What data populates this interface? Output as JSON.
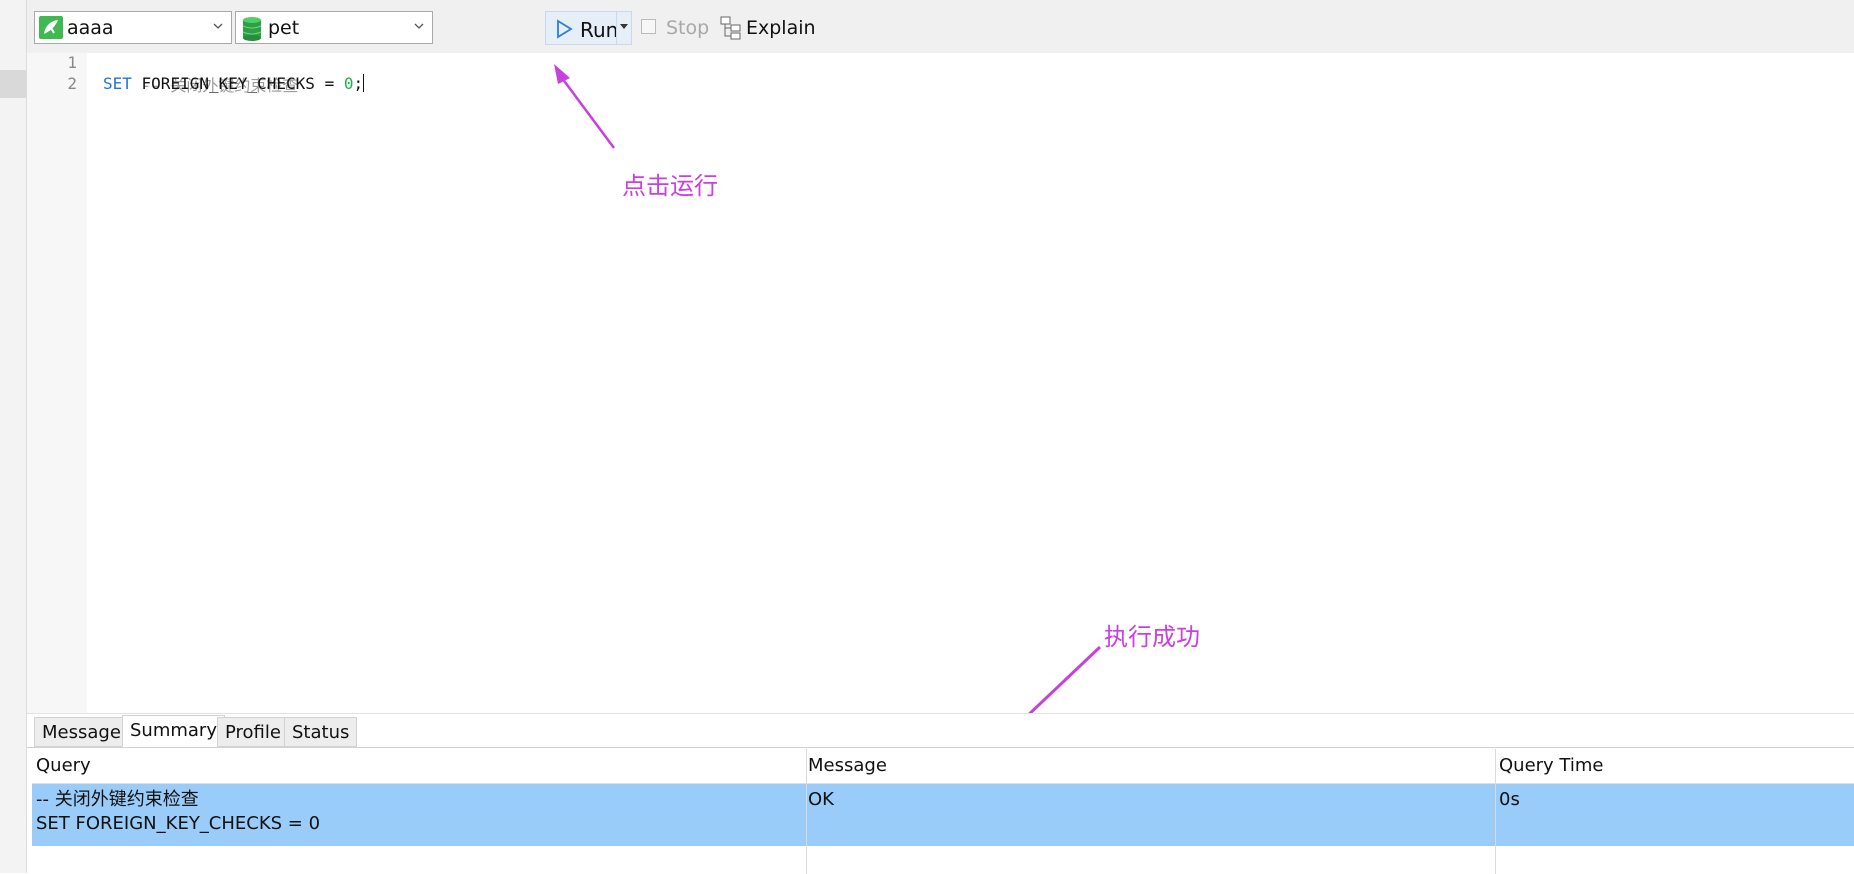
{
  "toolbar": {
    "connection": "aaaa",
    "database": "pet",
    "run_label": "Run",
    "stop_label": "Stop",
    "explain_label": "Explain"
  },
  "editor": {
    "lines": [
      {
        "number": "1",
        "comment": "-- 关闭外键约束检查"
      },
      {
        "number": "2",
        "keyword": "SET",
        "rest": " FOREIGN_KEY_CHECKS = ",
        "value": "0",
        "end": ";"
      }
    ]
  },
  "annotations": {
    "run_hint": "点击运行",
    "success_hint": "执行成功",
    "color": "#c93fe0"
  },
  "results": {
    "tabs": [
      "Message",
      "Summary",
      "Profile",
      "Status"
    ],
    "active_tab": "Summary",
    "columns": [
      "Query",
      "Message",
      "Query Time"
    ],
    "rows": [
      {
        "query_line1": "-- 关闭外键约束检查",
        "query_line2": "SET FOREIGN_KEY_CHECKS = 0",
        "message": "OK",
        "time": "0s"
      }
    ],
    "selected_row_color": "#99ccf8"
  }
}
